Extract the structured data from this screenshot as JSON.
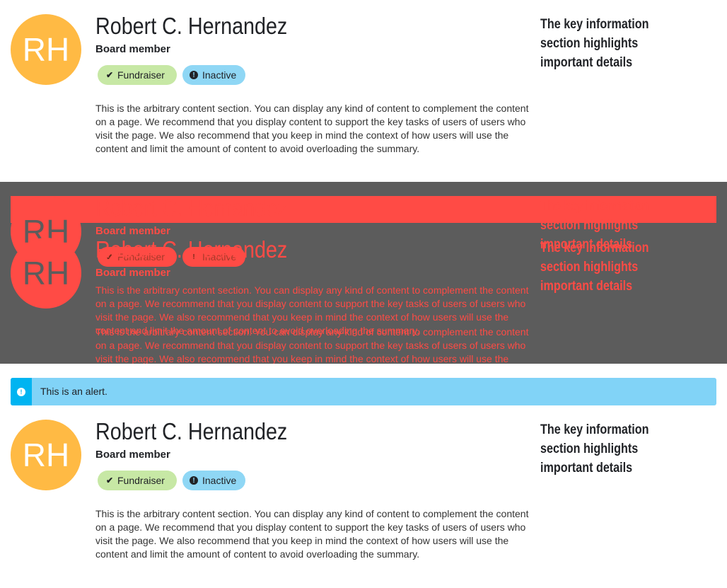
{
  "summary": {
    "initials": "RH",
    "name": "Robert C. Hernandez",
    "title": "Board member",
    "badges": [
      {
        "label": "Fundraiser",
        "type": "success",
        "icon": "check-icon"
      },
      {
        "label": "Inactive",
        "type": "info",
        "icon": "exclamation-circle-icon"
      }
    ],
    "content": "This is the arbitrary content section. You can display any kind of content to complement the content on a page. We recommend that you display content to support the key tasks of users of users who visit the page. We also recommend that you keep in mind the context of how users will use the content and limit the amount of content to avoid overloading the summary.",
    "key_info": "The key information section highlights important details"
  },
  "alert": {
    "text": "This is an alert.",
    "icon": "exclamation-circle-icon"
  },
  "colors": {
    "avatar": "#FFBA44",
    "badge_success": "#C7E8A5",
    "badge_info": "#8FD7F5",
    "alert_bg": "#81D3F7",
    "alert_accent": "#00B4F1",
    "overlay_bg": "#5C5C5C",
    "overlay_fg": "#FF4B45"
  }
}
